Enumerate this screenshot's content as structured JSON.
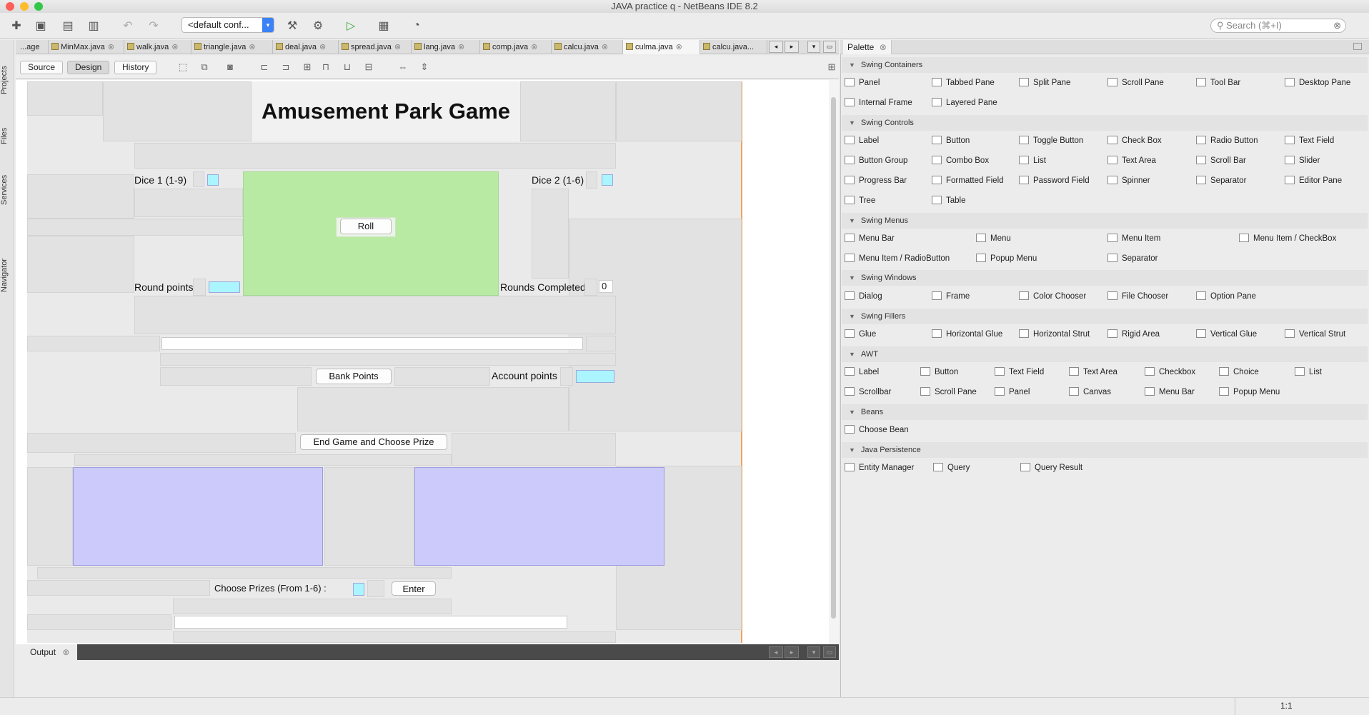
{
  "window": {
    "title": "JAVA practice q - NetBeans IDE 8.2"
  },
  "toolbar": {
    "config_label": "<default conf...",
    "search_placeholder": "Search (⌘+I)"
  },
  "side_tabs": [
    "Projects",
    "Files",
    "Services",
    "Navigator"
  ],
  "editor_tabs": [
    {
      "label": "...age"
    },
    {
      "label": "MinMax.java"
    },
    {
      "label": "walk.java"
    },
    {
      "label": "triangle.java"
    },
    {
      "label": "deal.java"
    },
    {
      "label": "spread.java"
    },
    {
      "label": "lang.java"
    },
    {
      "label": "comp.java"
    },
    {
      "label": "calcu.java"
    },
    {
      "label": "culma.java"
    },
    {
      "label": "calcu.java..."
    }
  ],
  "editor_modes": {
    "source": "Source",
    "design": "Design",
    "history": "History"
  },
  "form": {
    "title": "Amusement Park Game",
    "dice1_label": "Dice 1  (1-9)",
    "dice2_label": "Dice 2 (1-6)",
    "roll_button": "Roll",
    "round_points_label": "Round points",
    "rounds_completed_label": "Rounds Completed",
    "rounds_completed_value": "0",
    "bank_points_button": "Bank Points",
    "account_points_label": "Account points",
    "end_game_button": "End Game and Choose Prize",
    "choose_prizes_label": "Choose Prizes (From 1-6) :",
    "enter_button": "Enter"
  },
  "output": {
    "tab_label": "Output"
  },
  "palette": {
    "title": "Palette",
    "categories": [
      {
        "name": "Swing Containers",
        "items": [
          "Panel",
          "Tabbed Pane",
          "Split Pane",
          "Scroll Pane",
          "Tool Bar",
          "Desktop Pane",
          "Internal Frame",
          "Layered Pane"
        ]
      },
      {
        "name": "Swing Controls",
        "items": [
          "Label",
          "Button",
          "Toggle Button",
          "Check Box",
          "Radio Button",
          "Text Field",
          "Button Group",
          "Combo Box",
          "List",
          "Text Area",
          "Scroll Bar",
          "Slider",
          "Progress Bar",
          "Formatted Field",
          "Password Field",
          "Spinner",
          "Separator",
          "Editor Pane",
          "Tree",
          "Table"
        ]
      },
      {
        "name": "Swing Menus",
        "items": [
          "Menu Bar",
          "Menu",
          "Menu Item",
          "Menu Item / CheckBox",
          "Menu Item / RadioButton",
          "Popup Menu",
          "Separator"
        ]
      },
      {
        "name": "Swing Windows",
        "items": [
          "Dialog",
          "Frame",
          "Color Chooser",
          "File Chooser",
          "Option Pane"
        ]
      },
      {
        "name": "Swing Fillers",
        "items": [
          "Glue",
          "Horizontal Glue",
          "Horizontal Strut",
          "Rigid Area",
          "Vertical Glue",
          "Vertical Strut"
        ]
      },
      {
        "name": "AWT",
        "items": [
          "Label",
          "Button",
          "Text Field",
          "Text Area",
          "Checkbox",
          "Choice",
          "List",
          "Scrollbar",
          "Scroll Pane",
          "Panel",
          "Canvas",
          "Menu Bar",
          "Popup Menu"
        ]
      },
      {
        "name": "Beans",
        "items": [
          "Choose Bean"
        ]
      },
      {
        "name": "Java Persistence",
        "items": [
          "Entity Manager",
          "Query",
          "Query Result"
        ]
      }
    ]
  },
  "status": {
    "position": "1:1"
  }
}
